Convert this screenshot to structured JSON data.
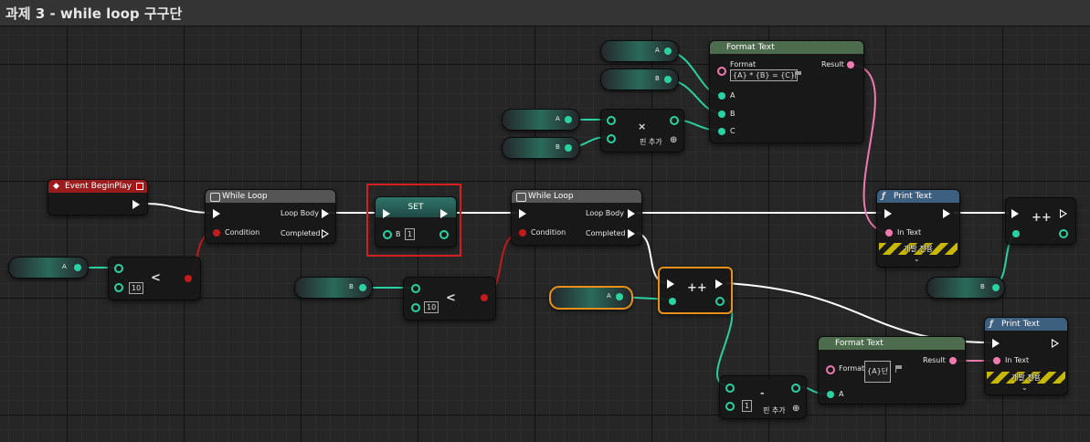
{
  "window": {
    "title": "과제 3 - while loop 구구단"
  },
  "colors": {
    "exec_wire": "#ffffff",
    "int_pin": "#2ad1a2",
    "string_pin": "#f07ab0",
    "bool_pin": "#c31b1b",
    "pure_function_header": "#4d6b4d",
    "function_header": "#3d5f80",
    "event_header": "#9b1c1c",
    "selection_outline": "#e8901a",
    "highlight_box": "#d22020"
  },
  "nodes": {
    "event_begin_play": {
      "title": "Event BeginPlay",
      "icon": "event-diamond-icon"
    },
    "while_loop_1": {
      "title": "While Loop",
      "loop_body": "Loop Body",
      "condition": "Condition",
      "completed": "Completed",
      "icon": "macro-icon"
    },
    "less_1": {
      "op": "<",
      "value": "10"
    },
    "var_a_1": {
      "name": "A"
    },
    "set_b": {
      "title": "SET",
      "pin": "B",
      "value": "1"
    },
    "var_b_1": {
      "name": "B"
    },
    "less_2": {
      "op": "<",
      "value": "10"
    },
    "while_loop_2": {
      "title": "While Loop",
      "loop_body": "Loop Body",
      "condition": "Condition",
      "completed": "Completed",
      "icon": "macro-icon"
    },
    "var_a_top": {
      "name": "A"
    },
    "var_b_top": {
      "name": "B"
    },
    "var_a_mult": {
      "name": "A"
    },
    "var_b_mult": {
      "name": "B"
    },
    "multiply": {
      "op": "×",
      "add_pin": "핀 추가"
    },
    "format_text_1": {
      "title": "Format Text",
      "format_label": "Format",
      "format_value": "{A} * {B} = {C}",
      "result": "Result",
      "pin_a": "A",
      "pin_b": "B",
      "pin_c": "C"
    },
    "print_text_1": {
      "title": "Print Text",
      "in_text": "In Text",
      "dev_only": "개발 전용",
      "icon": "function-icon"
    },
    "increment_1": {
      "op": "++"
    },
    "var_b_inc": {
      "name": "B"
    },
    "var_a_inc": {
      "name": "A"
    },
    "increment_2": {
      "op": "++"
    },
    "subtract": {
      "op": "-",
      "value": "1",
      "add_pin": "핀 추가"
    },
    "format_text_2": {
      "title": "Format Text",
      "format_label": "Format",
      "format_value": "{A}단",
      "result": "Result",
      "pin_a": "A"
    },
    "print_text_2": {
      "title": "Print Text",
      "in_text": "In Text",
      "dev_only": "개발 전용",
      "icon": "function-icon"
    }
  }
}
